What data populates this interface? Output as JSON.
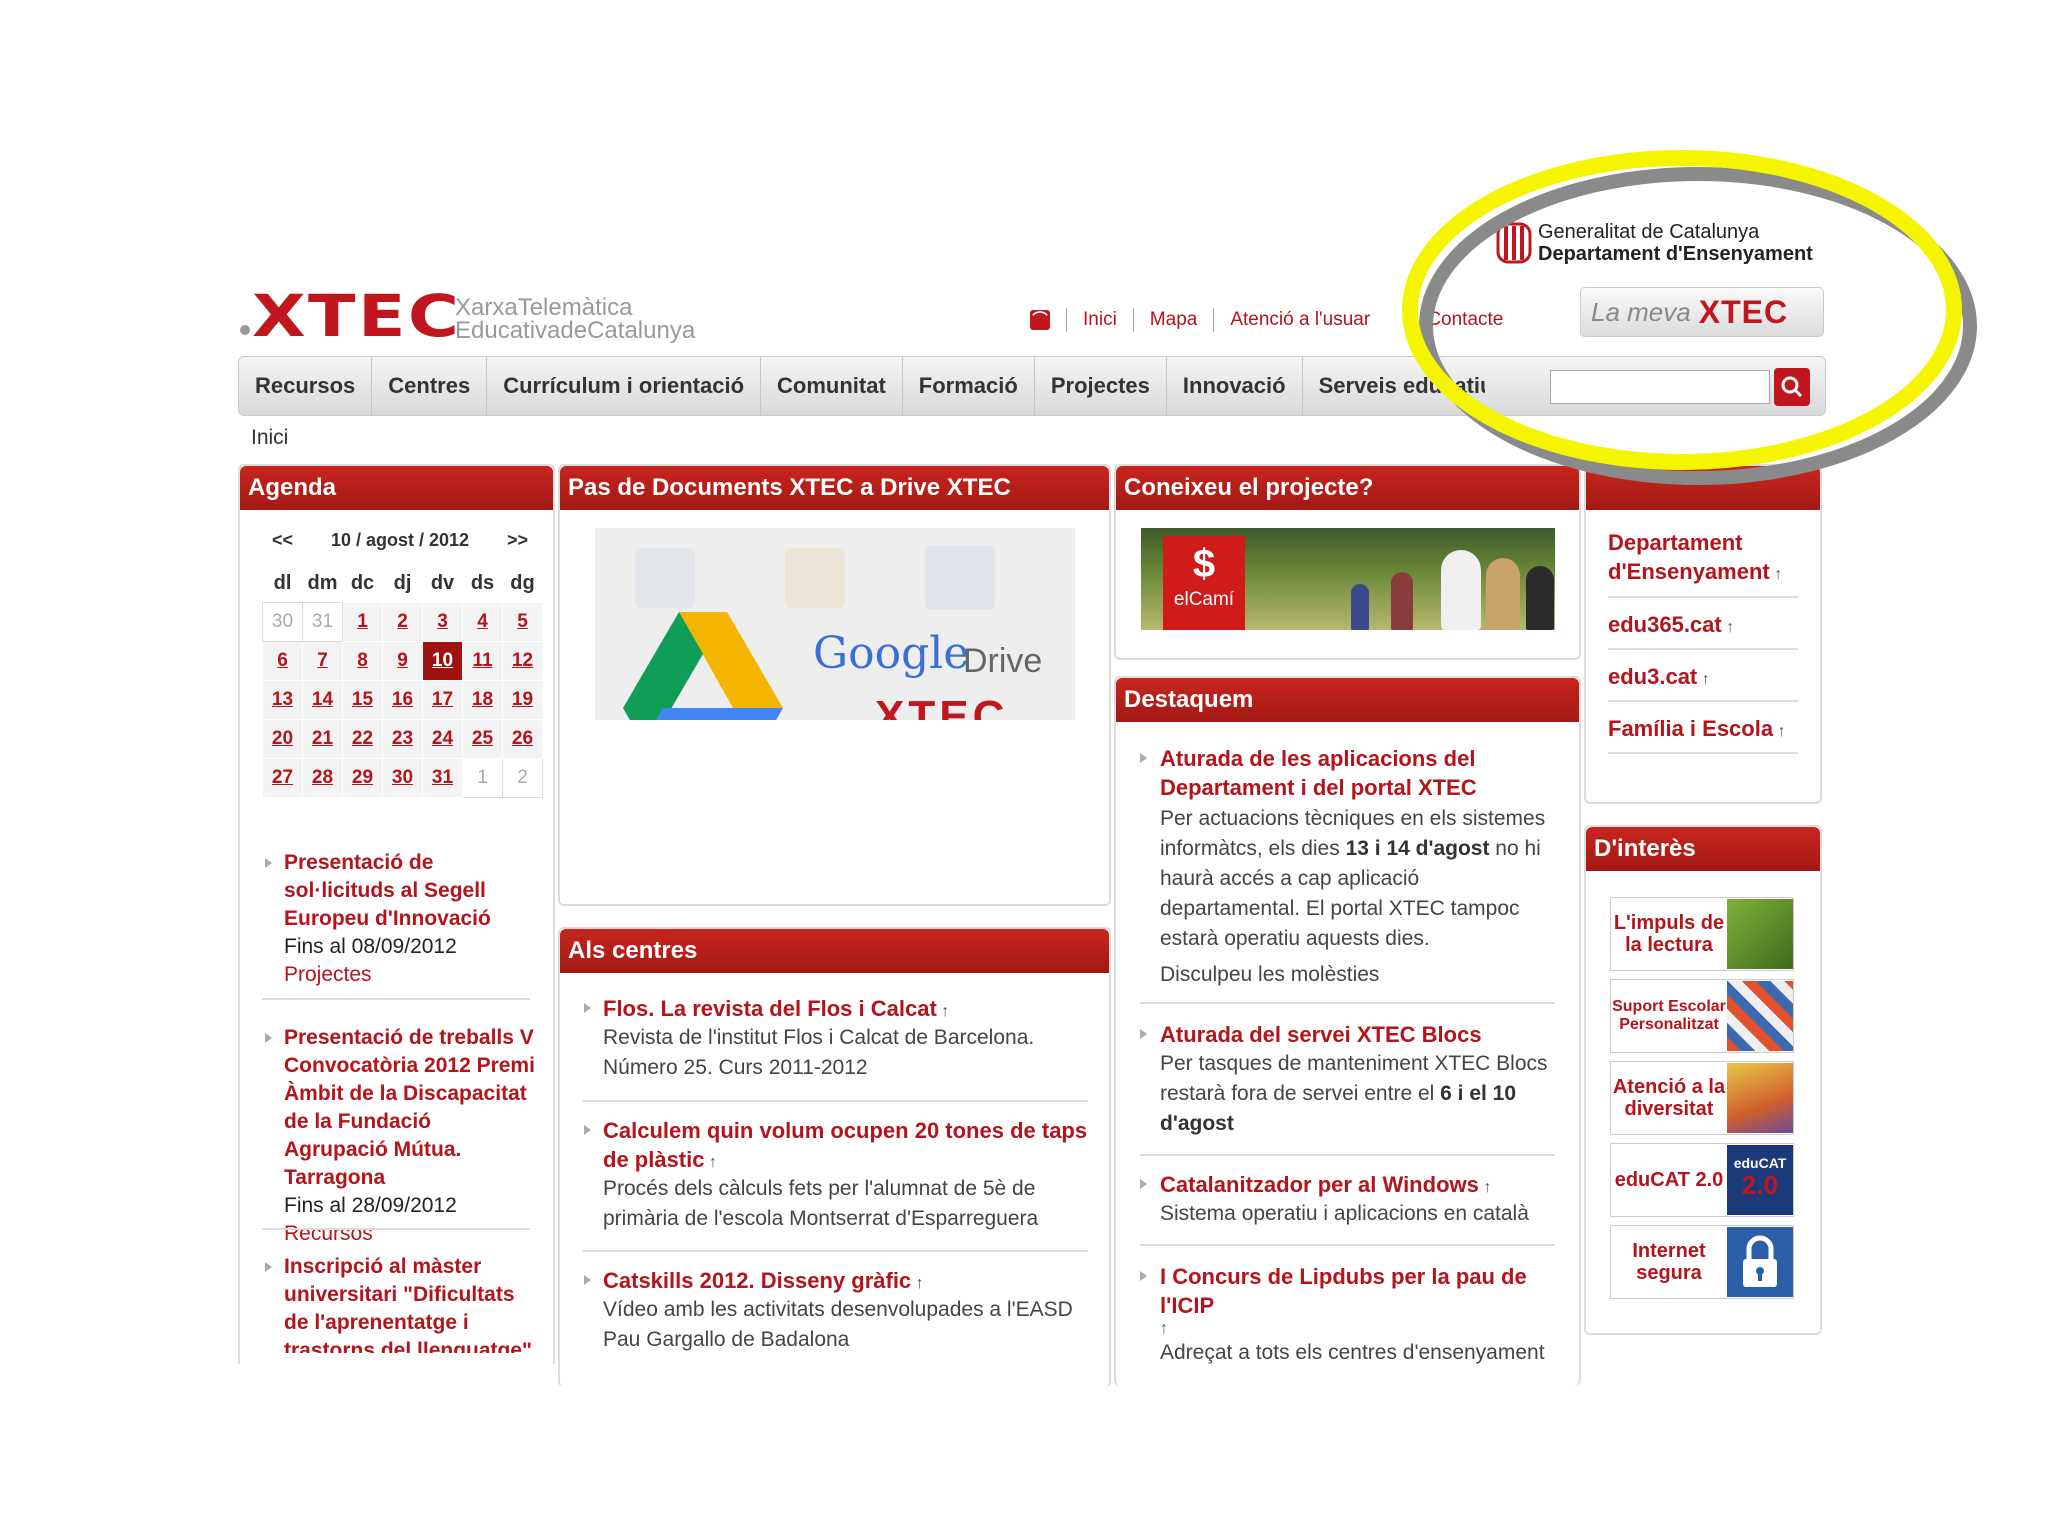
{
  "header": {
    "logo": "XTEC",
    "subtitle_line1": "XarxaTelemàtica",
    "subtitle_line2": "EducativadeCatalunya",
    "gencat_line1": "Generalitat de Catalunya",
    "gencat_line2": "Departament d'Ensenyament",
    "top_links": [
      "Inici",
      "Mapa",
      "Atenció a l'usuari",
      "Contacte"
    ],
    "la_meva": "La meva",
    "la_meva_logo": "XTEC"
  },
  "nav": {
    "items": [
      "Recursos",
      "Centres",
      "Currículum i orientació",
      "Comunitat",
      "Formació",
      "Projectes",
      "Innovació",
      "Serveis educatius"
    ],
    "search_value": ""
  },
  "breadcrumb": "Inici",
  "agenda": {
    "title": "Agenda",
    "prev": "<<",
    "next": ">>",
    "month_label": "10 / agost / 2012",
    "weekdays": [
      "dl",
      "dm",
      "dc",
      "dj",
      "dv",
      "ds",
      "dg"
    ],
    "weeks": [
      [
        "30",
        "31",
        "1",
        "2",
        "3",
        "4",
        "5"
      ],
      [
        "6",
        "7",
        "8",
        "9",
        "10",
        "11",
        "12"
      ],
      [
        "13",
        "14",
        "15",
        "16",
        "17",
        "18",
        "19"
      ],
      [
        "20",
        "21",
        "22",
        "23",
        "24",
        "25",
        "26"
      ],
      [
        "27",
        "28",
        "29",
        "30",
        "31",
        "1",
        "2"
      ]
    ],
    "events": [
      {
        "title": "Presentació de sol·licituds al Segell Europeu d'Innovació",
        "date": "Fins al 08/09/2012",
        "category": "Projectes"
      },
      {
        "title": "Presentació de treballs V Convocatòria 2012 Premi Àmbit de la Discapacitat de la Fundació Agrupació Mútua. Tarragona",
        "date": "Fins al 28/09/2012",
        "category": "Recursos"
      },
      {
        "title": "Inscripció al màster universitari \"Dificultats de l'aprenentatge i trastorns del llenguatge\"",
        "date": "",
        "category": ""
      }
    ]
  },
  "drive_panel": {
    "title": "Pas de Documents XTEC a Drive XTEC",
    "image_text": "Google",
    "image_text2": "Drive",
    "image_text3": "XTEC"
  },
  "projecte_panel": {
    "title": "Coneixeu el projecte?",
    "image_label": "elCamí",
    "image_glyph": "$"
  },
  "centres": {
    "title": "Als centres",
    "items": [
      {
        "title": "Flos. La revista del Flos i Calcat",
        "desc": "Revista de l'institut Flos i Calcat de Barcelona. Número 25. Curs 2011-2012"
      },
      {
        "title": "Calculem quin volum ocupen 20 tones de taps de plàstic",
        "desc": "Procés dels càlculs fets per l'alumnat de 5è de primària de l'escola Montserrat d'Esparreguera"
      },
      {
        "title": "Catskills 2012. Disseny gràfic",
        "desc": "Vídeo amb les activitats desenvolupades a l'EASD Pau Gargallo de Badalona"
      }
    ]
  },
  "destaquem": {
    "title": "Destaquem",
    "items": [
      {
        "title": "Aturada de les aplicacions del Departament i del portal XTEC",
        "desc_a": "Per actuacions tècniques en els sistemes informàtcs, els dies ",
        "desc_b": "13 i 14 d'agost",
        "desc_c": " no hi haurà accés a cap aplicació departamental. El portal XTEC tampoc estarà operatiu aquests dies.",
        "desc2": "Disculpeu les molèsties"
      },
      {
        "title": "Aturada del servei XTEC Blocs",
        "desc_a": "Per tasques de manteniment XTEC Blocs restarà fora de servei entre el ",
        "desc_b": "6 i el 10 d'agost",
        "desc_c": ""
      },
      {
        "title": "Catalanitzador per al Windows",
        "desc_a": "Sistema operatiu i aplicacions en català",
        "desc_b": "",
        "desc_c": ""
      },
      {
        "title": "I Concurs de Lipdubs per la pau de l'ICIP",
        "desc_a": "Adreçat a tots els centres d'ensenyament",
        "desc_b": "",
        "desc_c": ""
      }
    ]
  },
  "links_panel": {
    "items": [
      "Departament d'Ensenyament",
      "edu365.cat",
      "edu3.cat",
      "Família i Escola"
    ]
  },
  "interes": {
    "title": "D'interès",
    "items": [
      {
        "label": "L'impuls de la lectura"
      },
      {
        "label": "Suport Escolar Personalitzat"
      },
      {
        "label": "Atenció a la diversitat"
      },
      {
        "label": "eduCAT 2.0",
        "img_text": "eduCAT",
        "img_text2": "2.0"
      },
      {
        "label": "Internet segura"
      }
    ]
  },
  "arrow_glyph": "↑",
  "colors": {
    "accent": "#c0171e",
    "highlight": "#f5f500",
    "shadow": "#8a8a8a"
  }
}
